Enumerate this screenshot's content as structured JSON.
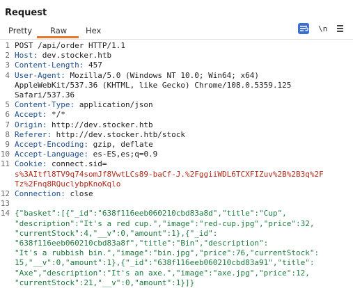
{
  "panel": {
    "title": "Request",
    "tabs": [
      "Pretty",
      "Raw",
      "Hex"
    ],
    "active_tab": "Raw",
    "accent_color": "#e8772e",
    "toolbar": {
      "wrap_icon": "wrap-lines-icon",
      "newline_label": "\\n",
      "menu_icon": "hamburger-menu-icon"
    }
  },
  "editor": {
    "lines": [
      {
        "num": "1",
        "parts": [
          {
            "c": "v",
            "t": "POST /api/order HTTP/1.1"
          }
        ]
      },
      {
        "num": "2",
        "parts": [
          {
            "c": "k",
            "t": "Host: "
          },
          {
            "c": "v",
            "t": "dev.stocker.htb"
          }
        ]
      },
      {
        "num": "3",
        "parts": [
          {
            "c": "k",
            "t": "Content-Length: "
          },
          {
            "c": "v",
            "t": "457"
          }
        ]
      },
      {
        "num": "4",
        "parts": [
          {
            "c": "k",
            "t": "User-Agent: "
          },
          {
            "c": "v",
            "t": "Mozilla/5.0 (Windows NT 10.0; Win64; x64)"
          }
        ]
      },
      {
        "num": "",
        "parts": [
          {
            "c": "v",
            "t": "AppleWebKit/537.36 (KHTML, like Gecko) Chrome/108.0.5359.125"
          }
        ]
      },
      {
        "num": "",
        "parts": [
          {
            "c": "v",
            "t": "Safari/537.36"
          }
        ]
      },
      {
        "num": "5",
        "parts": [
          {
            "c": "k",
            "t": "Content-Type: "
          },
          {
            "c": "v",
            "t": "application/json"
          }
        ]
      },
      {
        "num": "6",
        "parts": [
          {
            "c": "k",
            "t": "Accept: "
          },
          {
            "c": "v",
            "t": "*/*"
          }
        ]
      },
      {
        "num": "7",
        "parts": [
          {
            "c": "k",
            "t": "Origin: "
          },
          {
            "c": "v",
            "t": "http://dev.stocker.htb"
          }
        ]
      },
      {
        "num": "8",
        "parts": [
          {
            "c": "k",
            "t": "Referer: "
          },
          {
            "c": "v",
            "t": "http://dev.stocker.htb/stock"
          }
        ]
      },
      {
        "num": "9",
        "parts": [
          {
            "c": "k",
            "t": "Accept-Encoding: "
          },
          {
            "c": "v",
            "t": "gzip, deflate"
          }
        ]
      },
      {
        "num": "10",
        "parts": [
          {
            "c": "k",
            "t": "Accept-Language: "
          },
          {
            "c": "v",
            "t": "es-ES,es;q=0.9"
          }
        ]
      },
      {
        "num": "11",
        "parts": [
          {
            "c": "k",
            "t": "Cookie: "
          },
          {
            "c": "v",
            "t": "connect.sid="
          }
        ]
      },
      {
        "num": "",
        "parts": [
          {
            "c": "red",
            "t": "s%3AItfl8TV9q74somJf8VwtLCs89-baCf-J.%2FggiiWDL6TCXFIZuv%2B%2B3q%2F"
          }
        ]
      },
      {
        "num": "",
        "parts": [
          {
            "c": "red",
            "t": "Tz%2Fnq8RQuclybpKnoKqlo"
          }
        ]
      },
      {
        "num": "12",
        "parts": [
          {
            "c": "k",
            "t": "Connection: "
          },
          {
            "c": "v",
            "t": "close"
          }
        ]
      },
      {
        "num": "13",
        "parts": []
      },
      {
        "num": "14",
        "parts": [
          {
            "c": "json",
            "t": "{\"basket\":[{\"_id\":\"638f116eeb060210cbd83a8d\",\"title\":\"Cup\","
          }
        ]
      },
      {
        "num": "",
        "parts": [
          {
            "c": "json",
            "t": "\"description\":\"It's a red cup.\",\"image\":\"red-cup.jpg\",\"price\":32,"
          }
        ]
      },
      {
        "num": "",
        "parts": [
          {
            "c": "json",
            "t": "\"currentStock\":4,\"__v\":0,\"amount\":1},{\"_id\":"
          }
        ]
      },
      {
        "num": "",
        "parts": [
          {
            "c": "json",
            "t": "\"638f116eeb060210cbd83a8f\",\"title\":\"Bin\",\"description\":"
          }
        ]
      },
      {
        "num": "",
        "parts": [
          {
            "c": "json",
            "t": "\"It's a rubbish bin.\",\"image\":\"bin.jpg\",\"price\":76,\"currentStock\":"
          }
        ]
      },
      {
        "num": "",
        "parts": [
          {
            "c": "json",
            "t": "15,\"__v\":0,\"amount\":1},{\"_id\":\"638f116eeb060210cbd83a91\",\"title\":"
          }
        ]
      },
      {
        "num": "",
        "parts": [
          {
            "c": "json",
            "t": "\"Axe\",\"description\":\"It's an axe.\",\"image\":\"axe.jpg\",\"price\":12,"
          }
        ]
      },
      {
        "num": "",
        "parts": [
          {
            "c": "json",
            "t": "\"currentStock\":21,\"__v\":0,\"amount\":1}]}"
          }
        ]
      }
    ]
  }
}
